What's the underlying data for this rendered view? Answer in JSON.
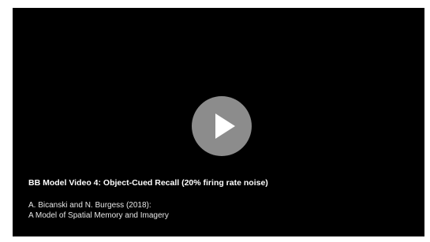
{
  "video": {
    "title": "BB Model Video 4: Object-Cued Recall (20% firing rate noise)",
    "credit_authors": "A. Bicanski and N. Burgess (2018):",
    "credit_paper": "A Model of Spatial Memory and Imagery",
    "play_icon": "play-icon",
    "colors": {
      "background": "#000000",
      "play_button": "#8c8c8c",
      "play_glyph": "#ffffff",
      "text": "#ffffff"
    }
  }
}
